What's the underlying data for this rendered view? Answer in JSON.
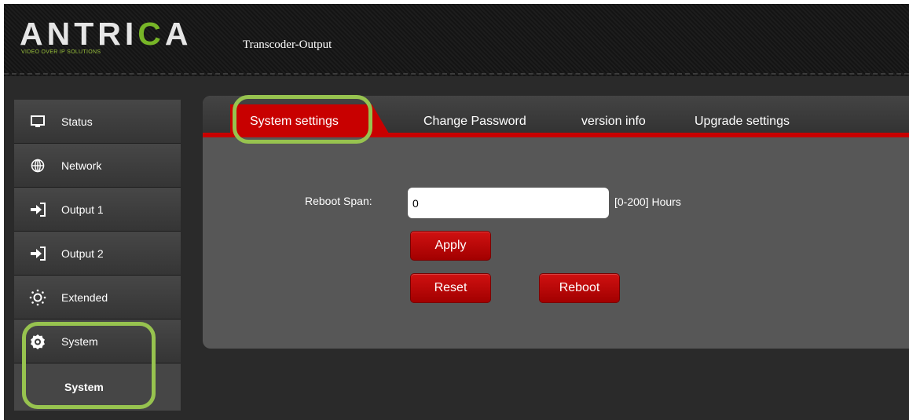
{
  "header": {
    "logo_text_1": "ANTRI",
    "logo_text_2": "C",
    "logo_text_3": "A",
    "logo_tagline": "VIDEO OVER IP SOLUTIONS",
    "page_title": "Transcoder-Output"
  },
  "sidebar": {
    "items": [
      {
        "label": "Status",
        "icon": "monitor-icon"
      },
      {
        "label": "Network",
        "icon": "globe-icon"
      },
      {
        "label": "Output 1",
        "icon": "sign-in-icon"
      },
      {
        "label": "Output 2",
        "icon": "sign-in-icon"
      },
      {
        "label": "Extended",
        "icon": "sun-dots-icon"
      },
      {
        "label": "System",
        "icon": "gear-icon"
      }
    ],
    "sub_items": [
      {
        "label": "System"
      }
    ]
  },
  "tabs": [
    {
      "label": "System settings",
      "active": true
    },
    {
      "label": "Change Password",
      "active": false
    },
    {
      "label": "version info",
      "active": false
    },
    {
      "label": "Upgrade settings",
      "active": false
    }
  ],
  "form": {
    "reboot_span_label": "Reboot Span:",
    "reboot_span_value": "0",
    "reboot_span_hint": "[0-200] Hours"
  },
  "buttons": {
    "apply": "Apply",
    "reset": "Reset",
    "reboot": "Reboot"
  },
  "colors": {
    "accent_red": "#c80000",
    "highlight_green": "#97c34f",
    "brand_green": "#77b527"
  }
}
